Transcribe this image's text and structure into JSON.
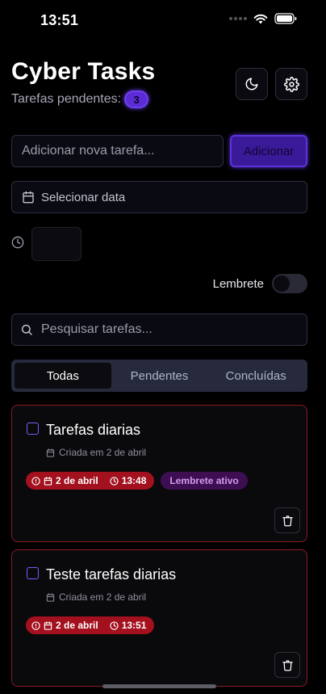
{
  "status_bar": {
    "time": "13:51"
  },
  "header": {
    "title": "Cyber Tasks",
    "pending_label": "Tarefas pendentes:",
    "pending_count": "3"
  },
  "form": {
    "task_placeholder": "Adicionar nova tarefa...",
    "add_label": "Adicionar",
    "date_label": "Selecionar data",
    "reminder_label": "Lembrete",
    "reminder_enabled": false
  },
  "search": {
    "placeholder": "Pesquisar tarefas..."
  },
  "tabs": [
    {
      "label": "Todas",
      "active": true
    },
    {
      "label": "Pendentes",
      "active": false
    },
    {
      "label": "Concluídas",
      "active": false
    }
  ],
  "tasks": [
    {
      "title": "Tarefas diarias",
      "created": "Criada em 2 de abril",
      "due_date": "2 de abril",
      "due_time": "13:48",
      "reminder_badge": "Lembrete ativo",
      "done": false
    },
    {
      "title": "Teste tarefas diarias",
      "created": "Criada em 2 de abril",
      "due_date": "2 de abril",
      "due_time": "13:51",
      "done": false
    }
  ],
  "colors": {
    "accent": "#5b2bd6",
    "overdue": "#a3101e",
    "card_border": "#8a1a24",
    "reminder_badge_bg": "#3d0f52"
  },
  "icons": [
    "moon-icon",
    "gear-icon",
    "calendar-icon",
    "clock-icon",
    "search-icon",
    "alert-circle-icon",
    "trash-icon",
    "wifi-icon",
    "battery-icon"
  ]
}
